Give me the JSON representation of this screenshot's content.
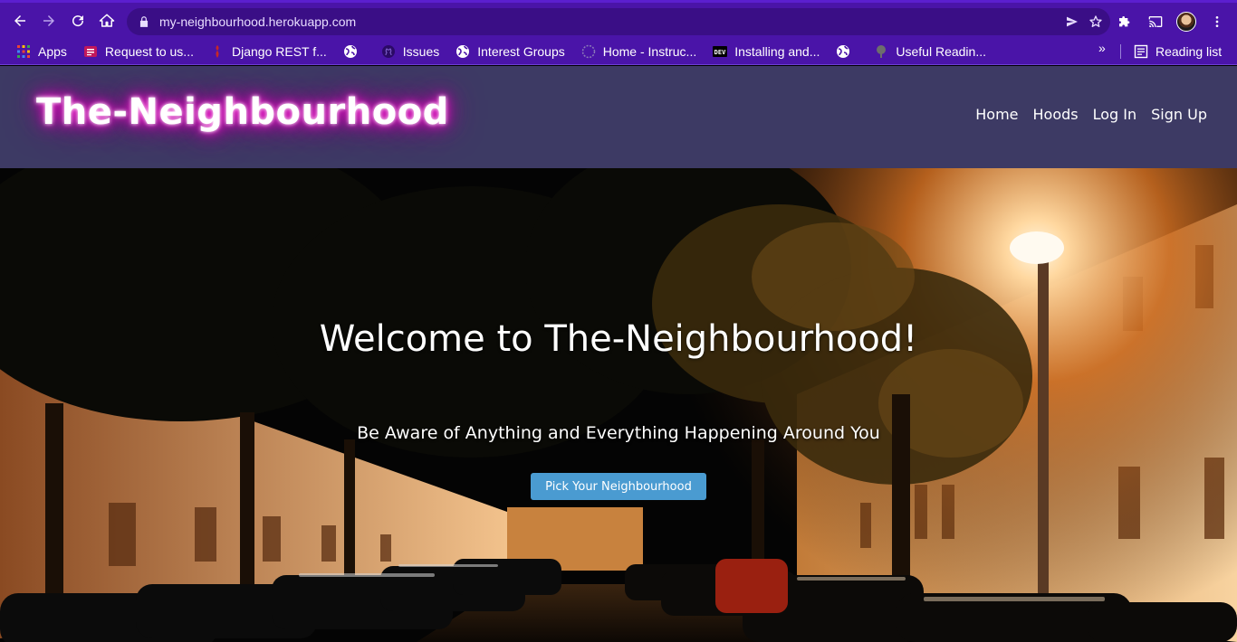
{
  "browser": {
    "url": "my-neighbourhood.herokuapp.com",
    "bookmarks": [
      {
        "label": "Apps",
        "icon": "apps-grid-icon"
      },
      {
        "label": "Request to us...",
        "icon": "list-icon"
      },
      {
        "label": "Django REST f...",
        "icon": "django-icon"
      },
      {
        "label": "",
        "icon": "globe-icon"
      },
      {
        "label": "Issues",
        "icon": "github-icon"
      },
      {
        "label": "Interest Groups",
        "icon": "globe-icon"
      },
      {
        "label": "Home - Instruc...",
        "icon": "moodle-icon"
      },
      {
        "label": "Installing and...",
        "icon": "dev-icon"
      },
      {
        "label": "",
        "icon": "globe-icon"
      },
      {
        "label": "Useful Readin...",
        "icon": "tree-icon"
      }
    ],
    "more_label": "»",
    "reading_list_label": "Reading list"
  },
  "site": {
    "brand": "The-Neighbourhood",
    "nav": [
      "Home",
      "Hoods",
      "Log In",
      "Sign Up"
    ]
  },
  "hero": {
    "title": "Welcome to The-Neighbourhood!",
    "subtitle": "Be Aware of Anything and Everything Happening Around You",
    "button_label": "Pick Your Neighbourhood"
  },
  "colors": {
    "browser_bg": "#4a14a8",
    "header_bg": "#3d3a64",
    "button_bg": "#4a9bd1"
  }
}
